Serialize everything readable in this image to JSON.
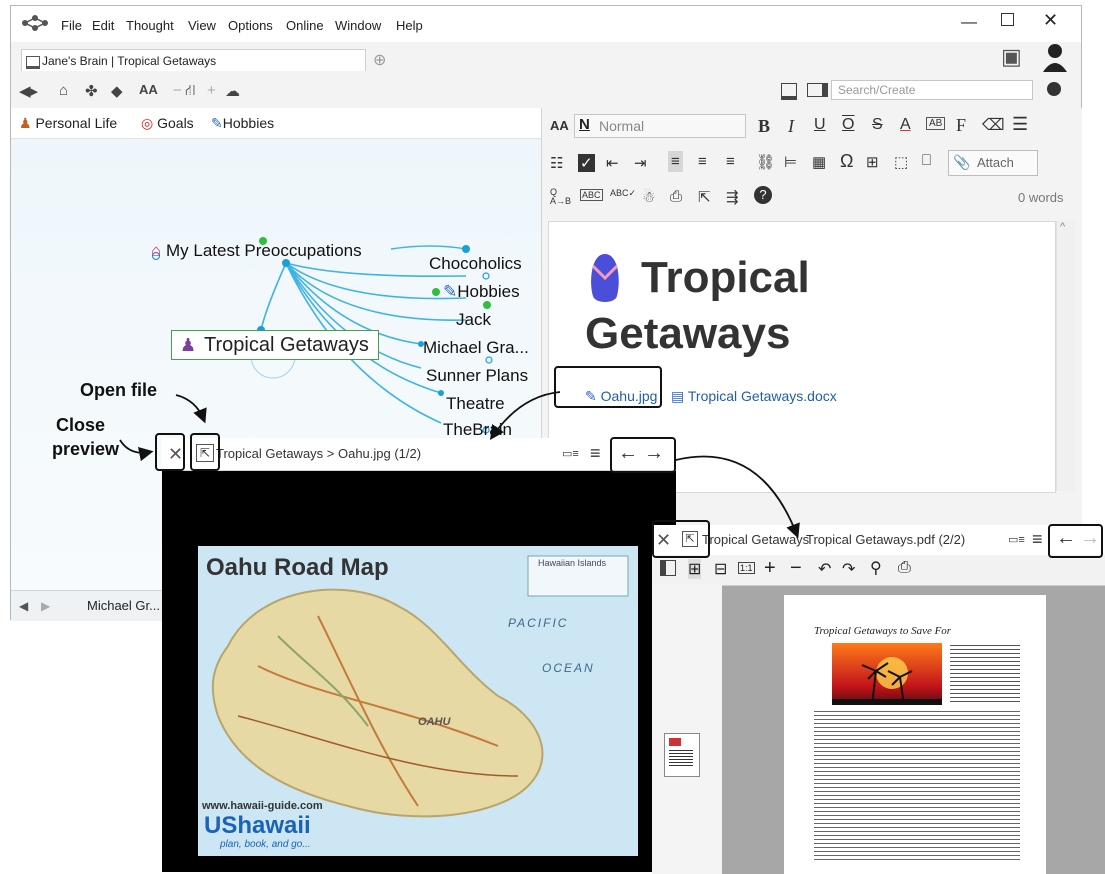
{
  "menu": [
    "File",
    "Edit",
    "Thought",
    "View",
    "Options",
    "Online",
    "Window",
    "Help"
  ],
  "tab": {
    "label": "Jane's Brain | Tropical Getaways"
  },
  "search": {
    "placeholder": "Search/Create"
  },
  "pins": [
    "Personal Life",
    "Goals",
    "Hobbies"
  ],
  "thoughts": {
    "parent": "My Latest Preoccupations",
    "active": "Tropical Getaways",
    "siblings": [
      "Chocoholics",
      "Hobbies",
      "Jack",
      "Michael Gra...",
      "Sunner Plans",
      "Theatre",
      "TheBrain"
    ]
  },
  "history_label": "Michael Gr...",
  "notes": {
    "style_value": "Normal",
    "attach_label": "Attach",
    "word_count": "0 words",
    "title_line1": "Tropical",
    "title_line2": "Getaways",
    "attachments": [
      "Oahu.jpg",
      "Tropical Getaways.docx"
    ]
  },
  "preview1": {
    "breadcrumb": "Tropical Getaways > Oahu.jpg (1/2)"
  },
  "map": {
    "title": "Oahu Road Map",
    "label_pacific": "PACIFIC",
    "label_ocean": "OCEAN",
    "label_oahu": "OAHU",
    "label_islands": "Hawaiian Islands",
    "site": "www.hawaii-guide.com",
    "logo": "UShawaii",
    "tagline": "plan, book, and go..."
  },
  "preview2": {
    "breadcrumb_a": "Tropical Getaways",
    "breadcrumb_b": "Tropical Getaways.pdf (2/2)"
  },
  "pdf": {
    "title": "Tropical Getaways to Save For"
  },
  "callouts": {
    "open_file": "Open file",
    "close_line1": "Close",
    "close_line2": "preview"
  },
  "colors": {
    "accent": "#1a9fd9",
    "green": "#2fbf3f",
    "active_border": "#46a046"
  }
}
